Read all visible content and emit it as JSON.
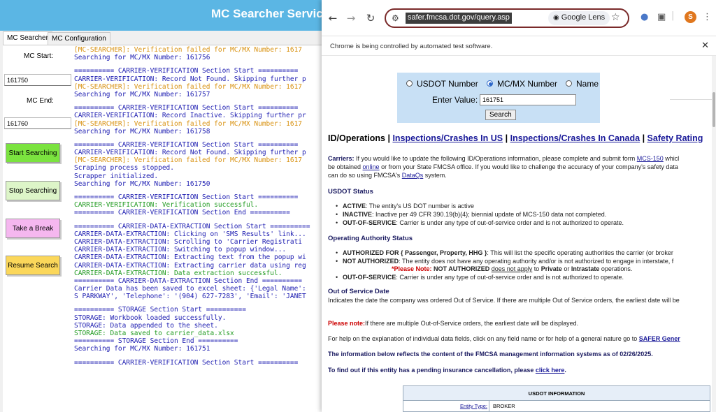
{
  "app": {
    "title": "MC Searcher Services",
    "tabs": [
      "MC Searcher",
      "MC Configuration"
    ],
    "mc_start_label": "MC Start:",
    "mc_start_value": "161750",
    "mc_end_label": "MC End:",
    "mc_end_value": "161760",
    "buttons": {
      "start": "Start Searching",
      "stop": "Stop Searching",
      "break": "Take a Break",
      "resume": "Resume Search"
    },
    "colors": {
      "header": "#5bb6e4",
      "start": "#7be33f",
      "stop": "#ddf5c8",
      "break": "#f5b7ef",
      "resume": "#fbd75a"
    },
    "log": [
      {
        "t": "[MC-SEARCHER]: Verification failed for MC/MX Number: 1617",
        "c": "orange"
      },
      {
        "t": "Searching for MC/MX Number: 161756",
        "c": "blue"
      },
      {
        "t": "",
        "c": "blank"
      },
      {
        "t": "========== CARRIER-VERIFICATION Section Start ==========",
        "c": "blue"
      },
      {
        "t": "CARRIER-VERIFICATION: Record Not Found. Skipping further p",
        "c": "blue"
      },
      {
        "t": "[MC-SEARCHER]: Verification failed for MC/MX Number: 1617",
        "c": "orange"
      },
      {
        "t": "Searching for MC/MX Number: 161757",
        "c": "blue"
      },
      {
        "t": "",
        "c": "blank"
      },
      {
        "t": "========== CARRIER-VERIFICATION Section Start ==========",
        "c": "blue"
      },
      {
        "t": "CARRIER-VERIFICATION: Record Inactive. Skipping further pr",
        "c": "blue"
      },
      {
        "t": "[MC-SEARCHER]: Verification failed for MC/MX Number: 1617",
        "c": "orange"
      },
      {
        "t": "Searching for MC/MX Number: 161758",
        "c": "blue"
      },
      {
        "t": "",
        "c": "blank"
      },
      {
        "t": "========== CARRIER-VERIFICATION Section Start ==========",
        "c": "blue"
      },
      {
        "t": "CARRIER-VERIFICATION: Record Not Found. Skipping further p",
        "c": "blue"
      },
      {
        "t": "[MC-SEARCHER]: Verification failed for MC/MX Number: 1617",
        "c": "orange"
      },
      {
        "t": "Scraping process stopped.",
        "c": "blue"
      },
      {
        "t": "Scrapper initialized.",
        "c": "blue"
      },
      {
        "t": "Searching for MC/MX Number: 161750",
        "c": "blue"
      },
      {
        "t": "",
        "c": "blank"
      },
      {
        "t": "========== CARRIER-VERIFICATION Section Start ==========",
        "c": "blue"
      },
      {
        "t": "CARRIER-VERIFICATION: Verification successful.",
        "c": "green"
      },
      {
        "t": "========== CARRIER-VERIFICATION Section End ==========",
        "c": "blue"
      },
      {
        "t": "",
        "c": "blank"
      },
      {
        "t": "========== CARRIER-DATA-EXTRACTION Section Start ==========",
        "c": "blue"
      },
      {
        "t": "CARRIER-DATA-EXTRACTION: Clicking on 'SMS Results' link...",
        "c": "blue"
      },
      {
        "t": "CARRIER-DATA-EXTRACTION: Scrolling to 'Carrier Registrati",
        "c": "blue"
      },
      {
        "t": "CARRIER-DATA-EXTRACTION: Switching to popup window...",
        "c": "blue"
      },
      {
        "t": "CARRIER-DATA-EXTRACTION: Extracting text from the popup wi",
        "c": "blue"
      },
      {
        "t": "CARRIER-DATA-EXTRACTION: Extracting carrier data using reg",
        "c": "blue"
      },
      {
        "t": "CARRIER-DATA-EXTRACTION: Data extraction successful.",
        "c": "green"
      },
      {
        "t": "========== CARRIER-DATA-EXTRACTION Section End ==========",
        "c": "blue"
      },
      {
        "t": "Carrier Data has been saved to excel sheet: {'Legal Name':",
        "c": "blue"
      },
      {
        "t": "S PARKWAY', 'Telephone': '(904) 627-7283', 'Email': 'JANET",
        "c": "blue"
      },
      {
        "t": "",
        "c": "blank"
      },
      {
        "t": "========== STORAGE Section Start ==========",
        "c": "blue"
      },
      {
        "t": "STORAGE: Workbook loaded successfully.",
        "c": "blue"
      },
      {
        "t": "STORAGE: Data appended to the sheet.",
        "c": "blue"
      },
      {
        "t": "STORAGE: Data saved to carrier_data.xlsx",
        "c": "green"
      },
      {
        "t": "========== STORAGE Section End ==========",
        "c": "blue"
      },
      {
        "t": "Searching for MC/MX Number: 161751",
        "c": "blue"
      },
      {
        "t": "",
        "c": "blank"
      },
      {
        "t": "========== CARRIER-VERIFICATION Section Start ==========",
        "c": "blue"
      }
    ]
  },
  "browser": {
    "url": "safer.fmcsa.dot.gov/query.asp",
    "lens_label": "Google Lens",
    "avatar_letter": "S",
    "infobar_text": "Chrome is being controlled by automated test software.",
    "icons": [
      "back-icon",
      "forward-icon",
      "reload-icon",
      "tune-icon",
      "lens-icon",
      "star-icon",
      "extension-icon",
      "puzzle-icon",
      "menu-icon",
      "close-icon"
    ]
  },
  "page": {
    "radios": [
      "USDOT Number",
      "MC/MX Number",
      "Name"
    ],
    "selected_radio": "MC/MX Number",
    "enter_label": "Enter Value:",
    "enter_value": "161751",
    "search_label": "Search",
    "ops_title": "ID/Operations",
    "sep": "|",
    "link_us": "Inspections/Crashes In US",
    "link_canada": "Inspections/Crashes In Canada",
    "link_rating": "Safety Rating",
    "carriers_label": "Carriers:",
    "carriers_text1": " If you would like to update the following ID/Operations information, please complete and submit form ",
    "mcs150": "MCS-150",
    "carriers_text1b": " whicl",
    "carriers_text2a": "be obtained ",
    "online": "online",
    "carriers_text2b": " or from your State FMCSA office. If you would like to challenge the accuracy of your company's safety data",
    "carriers_text3a": "can do so using FMCSA's ",
    "dataqs": "DataQs",
    "carriers_text3b": " system.",
    "usdot_status_h": "USDOT Status",
    "active_b": "ACTIVE",
    "active_t": ": The entity's US DOT number is active",
    "inactive_b": "INACTIVE",
    "inactive_t": ": Inactive per 49 CFR 390.19(b)(4); biennial update of MCS-150 data not completed.",
    "oos_b": "OUT-OF-SERVICE",
    "oos_t": ": Carrier is under any type of out-of-service order and is not authorized to operate.",
    "op_auth_h": "Operating Authority Status",
    "auth_b": "AUTHORIZED FOR { Passenger, Property, HHG }",
    "auth_t": ": This will list the specific operating authorities the carrier (or broker",
    "notauth_b": "NOT AUTHORIZED",
    "notauth_t": ": The entity does not have any operating authority and/or is not authorized to engage in interstate, f",
    "note_red": "*Please Note: ",
    "note_b1": "NOT AUTHORIZED",
    "note_u": "does not apply",
    "note_to": " to ",
    "note_private": "Private",
    "note_or": " or ",
    "note_intra": "Intrastate",
    "note_ops": " operations.",
    "oos2_b": "OUT-OF-SERVICE",
    "oos2_t": ": Carrier is under any type of out-of-service order and is not authorized to operate.",
    "oos_date_h": "Out of Service Date",
    "oos_date_t": "Indicates the date the company was ordered Out of Service. If there are multiple Out of Service orders, the earliest date will be",
    "please_note": "Please note:",
    "please_note_t": "If there are multiple Out-of-Service orders, the earliest date will be displayed.",
    "help_t": "For help on the explanation of individual data fields, click on any field name or for help of a general nature go to ",
    "safer_gen": "SAFER Gener",
    "reflects_t": "The information below reflects the content of the FMCSA management information systems as of ",
    "reflects_date": "02/26/2025",
    "reflects_end": ".",
    "pending_t": "To find out if this entity has a pending insurance cancellation, please ",
    "click_here": "click here",
    "pending_end": ".",
    "table_title": "USDOT INFORMATION",
    "entity_type_label": "Entity Type:",
    "entity_type_value": "BROKER"
  }
}
